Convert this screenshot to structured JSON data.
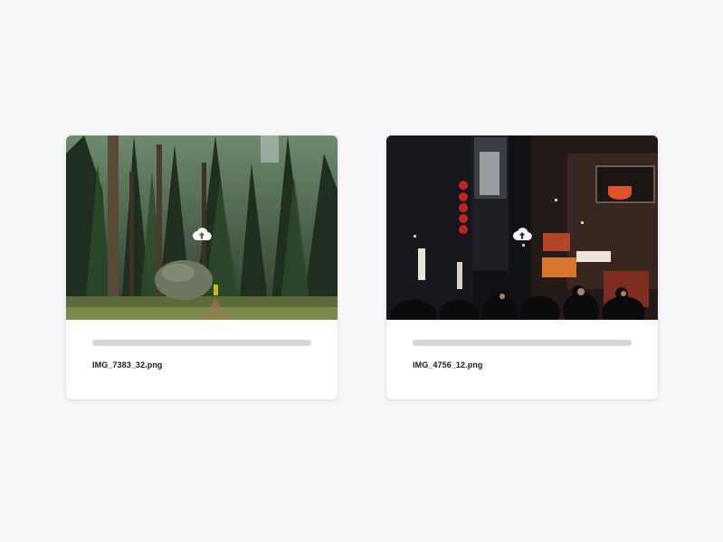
{
  "files": [
    {
      "name": "IMG_7383_32.png",
      "upload_icon": "cloud-upload-icon",
      "upload_progress": 0
    },
    {
      "name": "IMG_4756_12.png",
      "upload_icon": "cloud-upload-icon",
      "upload_progress": 0
    }
  ],
  "colors": {
    "background": "#f8f7fa",
    "card": "#ffffff",
    "progress_track": "#d7d7d7",
    "filename_text": "#1d1d1f"
  }
}
